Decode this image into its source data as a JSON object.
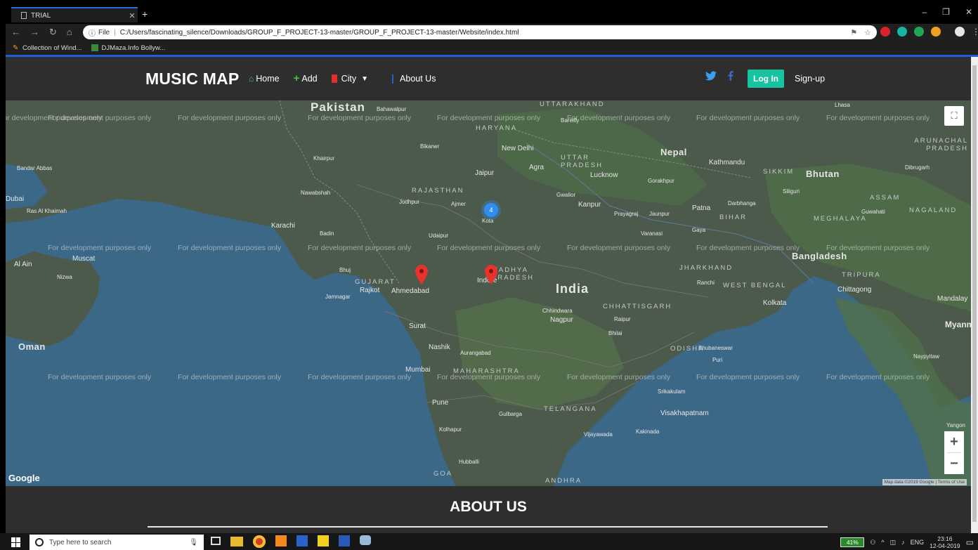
{
  "browser": {
    "tab_title": "TRIAL",
    "tab_close": "✕",
    "new_tab": "+",
    "window_controls": [
      "–",
      "❐",
      "✕"
    ],
    "url_prefix": "File",
    "url": "C:/Users/fascinating_silence/Downloads/GROUP_F_PROJECT-13-master/GROUP_F_PROJECT-13-master/Website/index.html",
    "bookmarks": [
      "Collection of Wind...",
      "DJMaza.Info Bollyw..."
    ]
  },
  "header": {
    "brand": "MUSIC MAP",
    "nav": {
      "home": "Home",
      "add": "Add",
      "city": "City",
      "about": "About Us"
    },
    "login": "Log In",
    "signup": "Sign-up"
  },
  "map": {
    "watermark": "For development purposes only",
    "cluster_count": "4",
    "google": "Google",
    "attribution": "Map data ©2019 Google | Terms of Use",
    "zoom_in": "+",
    "zoom_out": "−",
    "places": {
      "pakistan": "Pakistan",
      "india": "India",
      "nepal": "Nepal",
      "bhutan": "Bhutan",
      "bangladesh": "Bangladesh",
      "oman": "Oman",
      "muscat": "Muscat",
      "karachi": "Karachi",
      "new_delhi": "New Delhi",
      "agra": "Agra",
      "jaipur": "Jaipur",
      "lucknow": "Lucknow",
      "kanpur": "Kanpur",
      "kathmandu": "Kathmandu",
      "patna": "Patna",
      "ahmedabad": "Ahmedabad",
      "rajkot": "Rajkot",
      "surat": "Surat",
      "indore": "Indore",
      "nagpur": "Nagpur",
      "nashik": "Nashik",
      "mumbai": "Mumbai",
      "pune": "Pune",
      "kolkata": "Kolkata",
      "chittagong": "Chittagong",
      "visakhapatnam": "Visakhapatnam",
      "raipur": "Raipur",
      "dubai": "Dubai",
      "bandar_abbas": "Bandar Abbas",
      "al_ain": "Al Ain",
      "mandalay": "Mandalay",
      "gujarat": "GUJARAT",
      "rajasthan": "RAJASTHAN",
      "madhya_pradesh": "MADHYA PRADESH",
      "maharashtra": "MAHARASHTRA",
      "telangana": "TELANGANA",
      "chhattisgarh": "CHHATTISGARH",
      "jharkhand": "JHARKHAND",
      "west_bengal": "WEST BENGAL",
      "odisha": "ODISHA",
      "uttar_pradesh": "UTTAR PRADESH",
      "uttarakhand": "UTTARAKHAND",
      "haryana": "HARYANA",
      "bihar": "BIHAR",
      "meghalaya": "MEGHALAYA",
      "assam": "ASSAM",
      "tripura": "TRIPURA",
      "nagaland": "NAGALAND",
      "arunachal": "ARUNACHAL PRADESH",
      "sikkim": "SIKKIM",
      "goa": "GOA",
      "andhra": "ANDHRA",
      "gwalior": "Gwalior",
      "jodhpur": "Jodhpur",
      "udaipur": "Udaipur",
      "ajmer": "Ajmer",
      "bikaner": "Bikaner",
      "kota": "Kota",
      "bhuj": "Bhuj",
      "jamnagar": "Jamnagar",
      "aurangabad": "Aurangabad",
      "kolhapur": "Kolhapur",
      "hubballi": "Hubballi",
      "gulbarga": "Gulbarga",
      "vijayawada": "Vijayawada",
      "kakinada": "Kakinada",
      "srikakulam": "Srikakulam",
      "bhubaneswar": "Bhubaneswar",
      "puri": "Puri",
      "ranchi": "Ranchi",
      "gaya": "Gaya",
      "varanasi": "Varanasi",
      "prayagraj": "Prayagraj",
      "jaunpur": "Jaunpur",
      "gorakhpur": "Gorakhpur",
      "bareilly": "Bareilly",
      "darbhanga": "Darbhanga",
      "siliguri": "Siliguri",
      "guwahati": "Guwahati",
      "naypyitaw": "Naypyitaw",
      "yangon": "Yangon",
      "myanmar": "Myanmar (Burma)",
      "nawabshah": "Nawabshah",
      "khairpur": "Khairpur",
      "bahawalpur": "Bahawalpur",
      "badin": "Badin",
      "ras_al_khaimah": "Ras Al Khaimah",
      "nizwa": "Nizwa",
      "bilaspur": "Bhilai",
      "chhindwara": "Chhindwara",
      "dibrugarh": "Dibrugarh",
      "lhasa": "Lhasa"
    }
  },
  "about": {
    "title": "ABOUT US"
  },
  "taskbar": {
    "search_placeholder": "Type here to search",
    "battery": "41%",
    "lang": "ENG",
    "time": "23:16",
    "date": "12-04-2019"
  }
}
